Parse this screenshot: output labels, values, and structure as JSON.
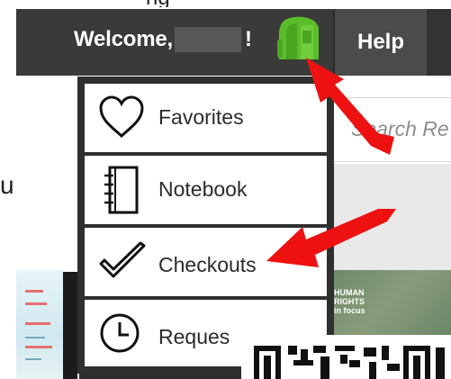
{
  "header": {
    "welcome_label": "Welcome,",
    "exclaim": "!",
    "help_label": "Help"
  },
  "top_clip_text": "ng",
  "search": {
    "placeholder": "Search Re"
  },
  "side_letter": "u",
  "menu": {
    "items": [
      {
        "label": "Favorites",
        "icon": "heart-icon"
      },
      {
        "label": "Notebook",
        "icon": "notebook-icon"
      },
      {
        "label": "Checkouts",
        "icon": "checkmark-icon"
      },
      {
        "label": "Reques",
        "icon": "clock-icon"
      }
    ]
  },
  "book_cover_text": "HUMAN RIGHTS in focus",
  "colors": {
    "topbar": "#3a3a3a",
    "help_button": "#4b4b4b",
    "backpack_green": "#5cbd2c",
    "annotation_arrow": "#ee1111",
    "menu_border": "#2f2f2f"
  }
}
